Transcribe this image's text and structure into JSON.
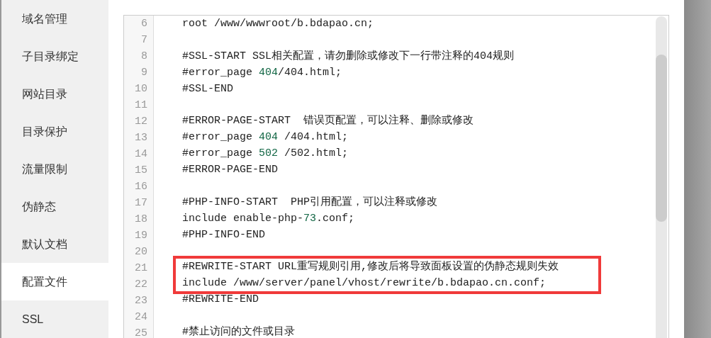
{
  "sidebar": {
    "items": [
      {
        "label": "域名管理",
        "selected": false
      },
      {
        "label": "子目录绑定",
        "selected": false
      },
      {
        "label": "网站目录",
        "selected": false
      },
      {
        "label": "目录保护",
        "selected": false
      },
      {
        "label": "流量限制",
        "selected": false
      },
      {
        "label": "伪静态",
        "selected": false
      },
      {
        "label": "默认文档",
        "selected": false
      },
      {
        "label": "配置文件",
        "selected": true
      },
      {
        "label": "SSL",
        "selected": false
      }
    ]
  },
  "editor": {
    "lines": [
      {
        "number": "6",
        "highlighted": false,
        "segments": [
          {
            "kind": "plain",
            "text": "root /www/wwwroot/b.bdapao.cn;"
          }
        ]
      },
      {
        "number": "7",
        "highlighted": false
      },
      {
        "number": "8",
        "highlighted": false,
        "segments": [
          {
            "kind": "plain",
            "text": "#SSL-START SSL相关配置，请勿删除或修改下一行带注释的404规则"
          }
        ]
      },
      {
        "number": "9",
        "highlighted": false,
        "segments": [
          {
            "kind": "plain",
            "text": "#error_page "
          },
          {
            "kind": "number",
            "text": "404"
          },
          {
            "kind": "plain",
            "text": "/404.html;"
          }
        ]
      },
      {
        "number": "10",
        "highlighted": false,
        "segments": [
          {
            "kind": "plain",
            "text": "#SSL-END"
          }
        ]
      },
      {
        "number": "11",
        "highlighted": false
      },
      {
        "number": "12",
        "highlighted": false,
        "segments": [
          {
            "kind": "plain",
            "text": "#ERROR-PAGE-START  错误页配置，可以注释、删除或修改"
          }
        ]
      },
      {
        "number": "13",
        "highlighted": false,
        "segments": [
          {
            "kind": "plain",
            "text": "#error_page "
          },
          {
            "kind": "number",
            "text": "404"
          },
          {
            "kind": "plain",
            "text": " /404.html;"
          }
        ]
      },
      {
        "number": "14",
        "highlighted": false,
        "segments": [
          {
            "kind": "plain",
            "text": "#error_page "
          },
          {
            "kind": "number",
            "text": "502"
          },
          {
            "kind": "plain",
            "text": " /502.html;"
          }
        ]
      },
      {
        "number": "15",
        "highlighted": false,
        "segments": [
          {
            "kind": "plain",
            "text": "#ERROR-PAGE-END"
          }
        ]
      },
      {
        "number": "16",
        "highlighted": false
      },
      {
        "number": "17",
        "highlighted": false,
        "segments": [
          {
            "kind": "plain",
            "text": "#PHP-INFO-START  PHP引用配置，可以注释或修改"
          }
        ]
      },
      {
        "number": "18",
        "highlighted": false,
        "segments": [
          {
            "kind": "plain",
            "text": "include enable-php-"
          },
          {
            "kind": "number",
            "text": "73"
          },
          {
            "kind": "plain",
            "text": ".conf;"
          }
        ]
      },
      {
        "number": "19",
        "highlighted": false,
        "segments": [
          {
            "kind": "plain",
            "text": "#PHP-INFO-END"
          }
        ]
      },
      {
        "number": "20",
        "highlighted": false
      },
      {
        "number": "21",
        "highlighted": true,
        "segments": [
          {
            "kind": "plain",
            "text": "#REWRITE-START URL重写规则引用,修改后将导致面板设置的伪静态规则失效"
          }
        ]
      },
      {
        "number": "22",
        "highlighted": true,
        "segments": [
          {
            "kind": "plain",
            "text": "include /www/server/panel/vhost/rewrite/b.bdapao.cn.conf;"
          }
        ]
      },
      {
        "number": "23",
        "highlighted": false,
        "segments": [
          {
            "kind": "plain",
            "text": "#REWRITE-END"
          }
        ]
      },
      {
        "number": "24",
        "highlighted": false
      },
      {
        "number": "25",
        "highlighted": false,
        "segments": [
          {
            "kind": "plain",
            "text": "#禁止访问的文件或目录"
          }
        ]
      }
    ]
  }
}
